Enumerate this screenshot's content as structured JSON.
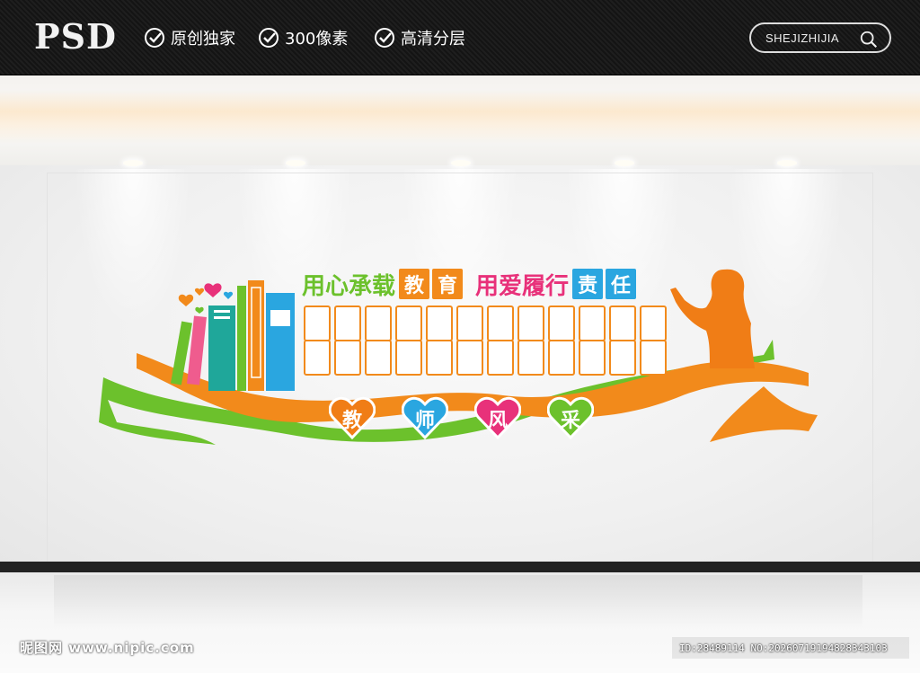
{
  "header": {
    "logo": "PSD",
    "features": [
      "原创独家",
      "300像素",
      "高清分层"
    ],
    "search_label": "SHEJIZHIJIA"
  },
  "wall_art": {
    "slogan_part1": "用心承载",
    "slogan_tag1": [
      "教",
      "育"
    ],
    "slogan_part2": "用爱履行",
    "slogan_tag2": [
      "责",
      "任"
    ],
    "hearts": [
      "教",
      "师",
      "风",
      "采"
    ],
    "colors": {
      "green": "#6cc12c",
      "orange": "#f28a1b",
      "pink": "#e8317a",
      "blue": "#2aa6e0",
      "teal": "#1fa79a"
    }
  },
  "watermark": {
    "left": "昵图网 www.nipic.com",
    "right": "ID:28489114 NO:20260719194828343103"
  }
}
